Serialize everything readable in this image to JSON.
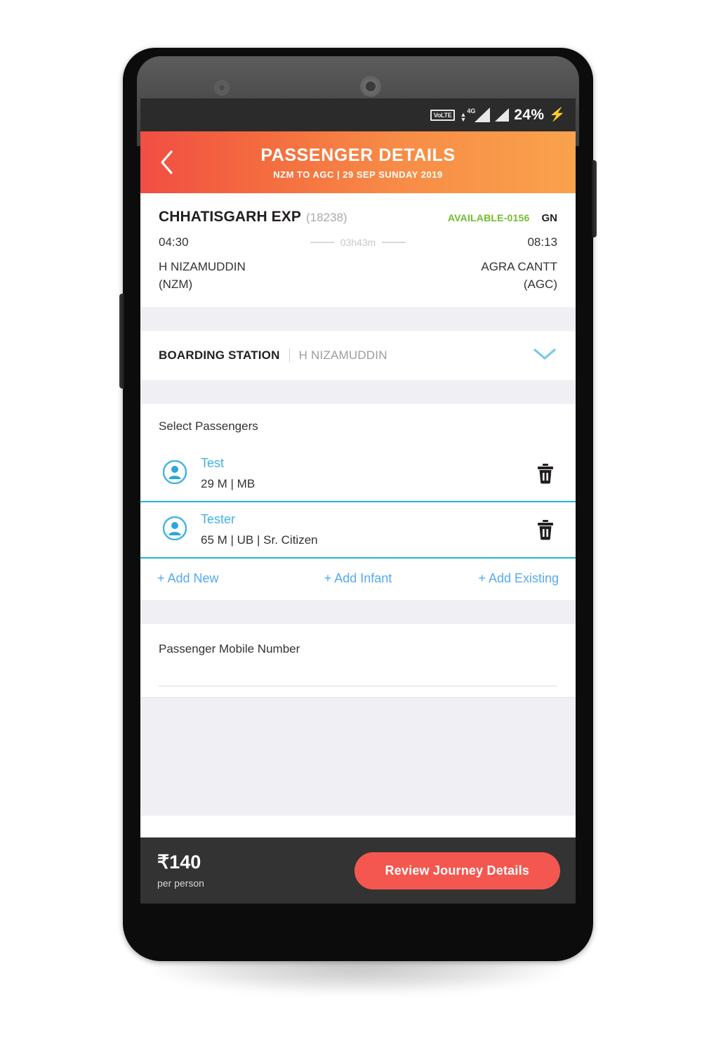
{
  "status_bar": {
    "volte_label": "VoLTE",
    "network_label": "4G",
    "battery_percent": "24%",
    "charging_icon": "bolt-icon",
    "signal_icon": "signal-bars-icon"
  },
  "header": {
    "back_icon": "back-chevron-icon",
    "title": "PASSENGER DETAILS",
    "subtitle": "NZM TO AGC | 29 SEP SUNDAY 2019",
    "gradient_from": "#f14e43",
    "gradient_to": "#faa24c"
  },
  "train": {
    "name": "CHHATISGARH EXP",
    "number": "(18238)",
    "availability": "AVAILABLE-0156",
    "availability_color": "#6fbe2c",
    "class": "GN",
    "depart_time": "04:30",
    "arrive_time": "08:13",
    "duration": "03h43m",
    "from_station": "H NIZAMUDDIN",
    "from_code": "(NZM)",
    "to_station": "AGRA CANTT",
    "to_code": "(AGC)"
  },
  "boarding": {
    "label": "BOARDING STATION",
    "value": "H NIZAMUDDIN",
    "chevron_icon": "chevron-down-icon"
  },
  "passengers": {
    "heading": "Select Passengers",
    "list": [
      {
        "name": "Test",
        "details": "29 M | MB",
        "avatar_icon": "person-icon",
        "delete_icon": "trash-icon"
      },
      {
        "name": "Tester",
        "details": "65 M | UB | Sr. Citizen",
        "avatar_icon": "person-icon",
        "delete_icon": "trash-icon"
      }
    ],
    "actions": {
      "add_new": "+ Add New",
      "add_infant": "+ Add Infant",
      "add_existing": "+ Add Existing"
    },
    "accent_color": "#25b4d8",
    "link_color": "#55aaf0"
  },
  "mobile": {
    "label": "Passenger Mobile Number",
    "value": "",
    "placeholder": ""
  },
  "bottom": {
    "fare": "₹140",
    "fare_sub": "per person",
    "cta_label": "Review Journey Details",
    "cta_color": "#f4574f"
  }
}
